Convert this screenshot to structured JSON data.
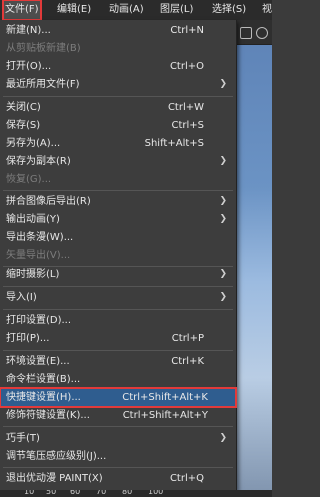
{
  "menubar": {
    "items": [
      {
        "label": "文件(F)",
        "active": true
      },
      {
        "label": "编辑(E)"
      },
      {
        "label": "动画(A)"
      },
      {
        "label": "图层(L)"
      },
      {
        "label": "选择(S)"
      },
      {
        "label": "视"
      }
    ]
  },
  "file_menu": {
    "items": [
      {
        "label": "新建(N)...",
        "shortcut": "Ctrl+N"
      },
      {
        "label": "从剪贴板新建(B)",
        "disabled": true
      },
      {
        "label": "打开(O)...",
        "shortcut": "Ctrl+O"
      },
      {
        "label": "最近所用文件(F)",
        "submenu": true
      },
      {
        "label": "关闭(C)",
        "shortcut": "Ctrl+W"
      },
      {
        "label": "保存(S)",
        "shortcut": "Ctrl+S"
      },
      {
        "label": "另存为(A)...",
        "shortcut": "Shift+Alt+S"
      },
      {
        "label": "保存为副本(R)",
        "submenu": true
      },
      {
        "label": "恢复(G)...",
        "disabled": true
      },
      {
        "label": "拼合图像后导出(R)",
        "submenu": true
      },
      {
        "label": "输出动画(Y)",
        "submenu": true
      },
      {
        "label": "导出条漫(W)..."
      },
      {
        "label": "矢量导出(V)...",
        "disabled": true
      },
      {
        "label": "缩时摄影(L)",
        "submenu": true
      },
      {
        "label": "导入(I)",
        "submenu": true
      },
      {
        "label": "打印设置(D)..."
      },
      {
        "label": "打印(P)...",
        "shortcut": "Ctrl+P"
      },
      {
        "label": "环境设置(E)...",
        "shortcut": "Ctrl+K"
      },
      {
        "label": "命令栏设置(B)..."
      },
      {
        "label": "快捷键设置(H)...",
        "shortcut": "Ctrl+Shift+Alt+K",
        "highlighted": true
      },
      {
        "label": "修饰符键设置(K)...",
        "shortcut": "Ctrl+Shift+Alt+Y"
      },
      {
        "label": "巧手(T)",
        "submenu": true
      },
      {
        "label": "调节笔压感应级别(J)..."
      },
      {
        "label": "退出优动漫 PAINT(X)",
        "shortcut": "Ctrl+Q"
      }
    ]
  },
  "zoom_bar": {
    "values": [
      "10",
      "50",
      "60",
      "70",
      "80",
      "100"
    ]
  },
  "colors": {
    "accent_highlight": "#2f5d8f",
    "annotation_red": "#e23a3a"
  }
}
